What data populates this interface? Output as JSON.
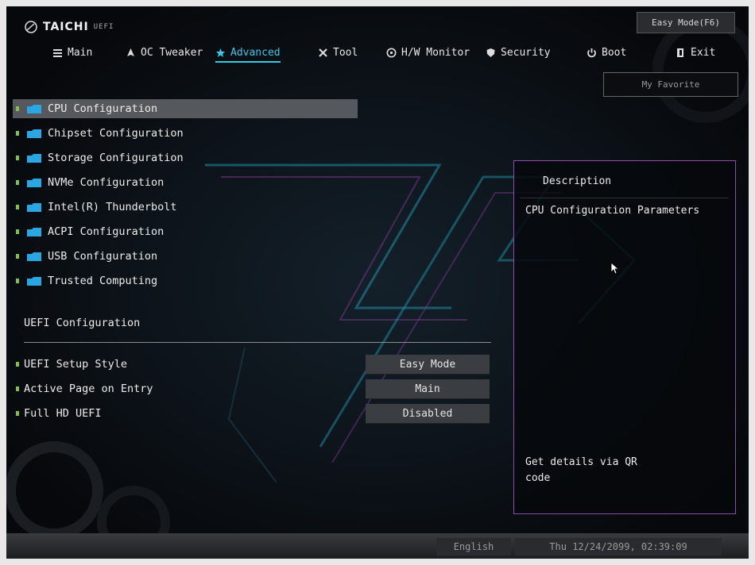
{
  "brand": {
    "logo": "TAICHI",
    "sub": "UEFI"
  },
  "header": {
    "easy_mode": "Easy Mode(F6)",
    "my_favorite": "My Favorite"
  },
  "tabs": [
    {
      "label": "Main",
      "icon": "list-icon"
    },
    {
      "label": "OC Tweaker",
      "icon": "rocket-icon"
    },
    {
      "label": "Advanced",
      "icon": "star-icon",
      "active": true
    },
    {
      "label": "Tool",
      "icon": "tools-icon"
    },
    {
      "label": "H/W Monitor",
      "icon": "monitor-icon"
    },
    {
      "label": "Security",
      "icon": "shield-icon"
    },
    {
      "label": "Boot",
      "icon": "power-icon"
    },
    {
      "label": "Exit",
      "icon": "exit-icon"
    }
  ],
  "menu": [
    {
      "label": "CPU Configuration",
      "selected": true
    },
    {
      "label": "Chipset Configuration"
    },
    {
      "label": "Storage Configuration"
    },
    {
      "label": "NVMe Configuration"
    },
    {
      "label": "Intel(R) Thunderbolt"
    },
    {
      "label": "ACPI Configuration"
    },
    {
      "label": "USB Configuration"
    },
    {
      "label": "Trusted Computing"
    }
  ],
  "uefi_section": "UEFI Configuration",
  "settings": [
    {
      "label": "UEFI Setup Style",
      "value": "Easy Mode"
    },
    {
      "label": "Active Page on Entry",
      "value": "Main"
    },
    {
      "label": "Full HD UEFI",
      "value": "Disabled"
    }
  ],
  "description": {
    "title": "Description",
    "text": "CPU Configuration Parameters",
    "qr": "Get details via QR code"
  },
  "footer": {
    "language": "English",
    "datetime": "Thu 12/24/2099, 02:39:09"
  },
  "colors": {
    "accent": "#35c9e8",
    "bullet": "#7fbf4c",
    "folder": "#2aa6e0",
    "panel_border": "#8a4fa8"
  }
}
